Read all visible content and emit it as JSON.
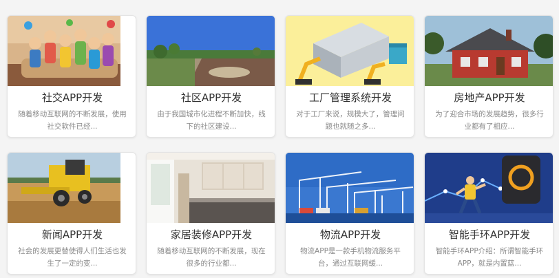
{
  "cards": [
    {
      "title": "社交APP开发",
      "desc": "随着移动互联网的不断发展，使用社交软件已经...",
      "image": "social-people-illustration"
    },
    {
      "title": "社区APP开发",
      "desc": "由于我国城市化进程不断加快，线下的社区建设...",
      "image": "community-park-photo"
    },
    {
      "title": "工厂管理系统开发",
      "desc": "对于工厂来说，规模大了，管理问题也就随之多...",
      "image": "factory-robot-arm-illustration"
    },
    {
      "title": "房地产APP开发",
      "desc": "为了迎合市场的发展趋势，很多行业都有了相应...",
      "image": "house-photo"
    },
    {
      "title": "新闻APP开发",
      "desc": "社会的发展更替使得人们生活也发生了一定的变...",
      "image": "harvester-field-photo"
    },
    {
      "title": "家居装修APP开发",
      "desc": "随着移动互联网的不断发展，现在很多的行业都...",
      "image": "kitchen-interior-photo"
    },
    {
      "title": "物流APP开发",
      "desc": "物流APP是一款手机物流服务平台，通过互联网缓...",
      "image": "port-cranes-photo"
    },
    {
      "title": "智能手环APP开发",
      "desc": "智能手环APP介绍：所谓智能手环APP，就是内置蓝...",
      "image": "smart-band-runner-illustration"
    }
  ]
}
